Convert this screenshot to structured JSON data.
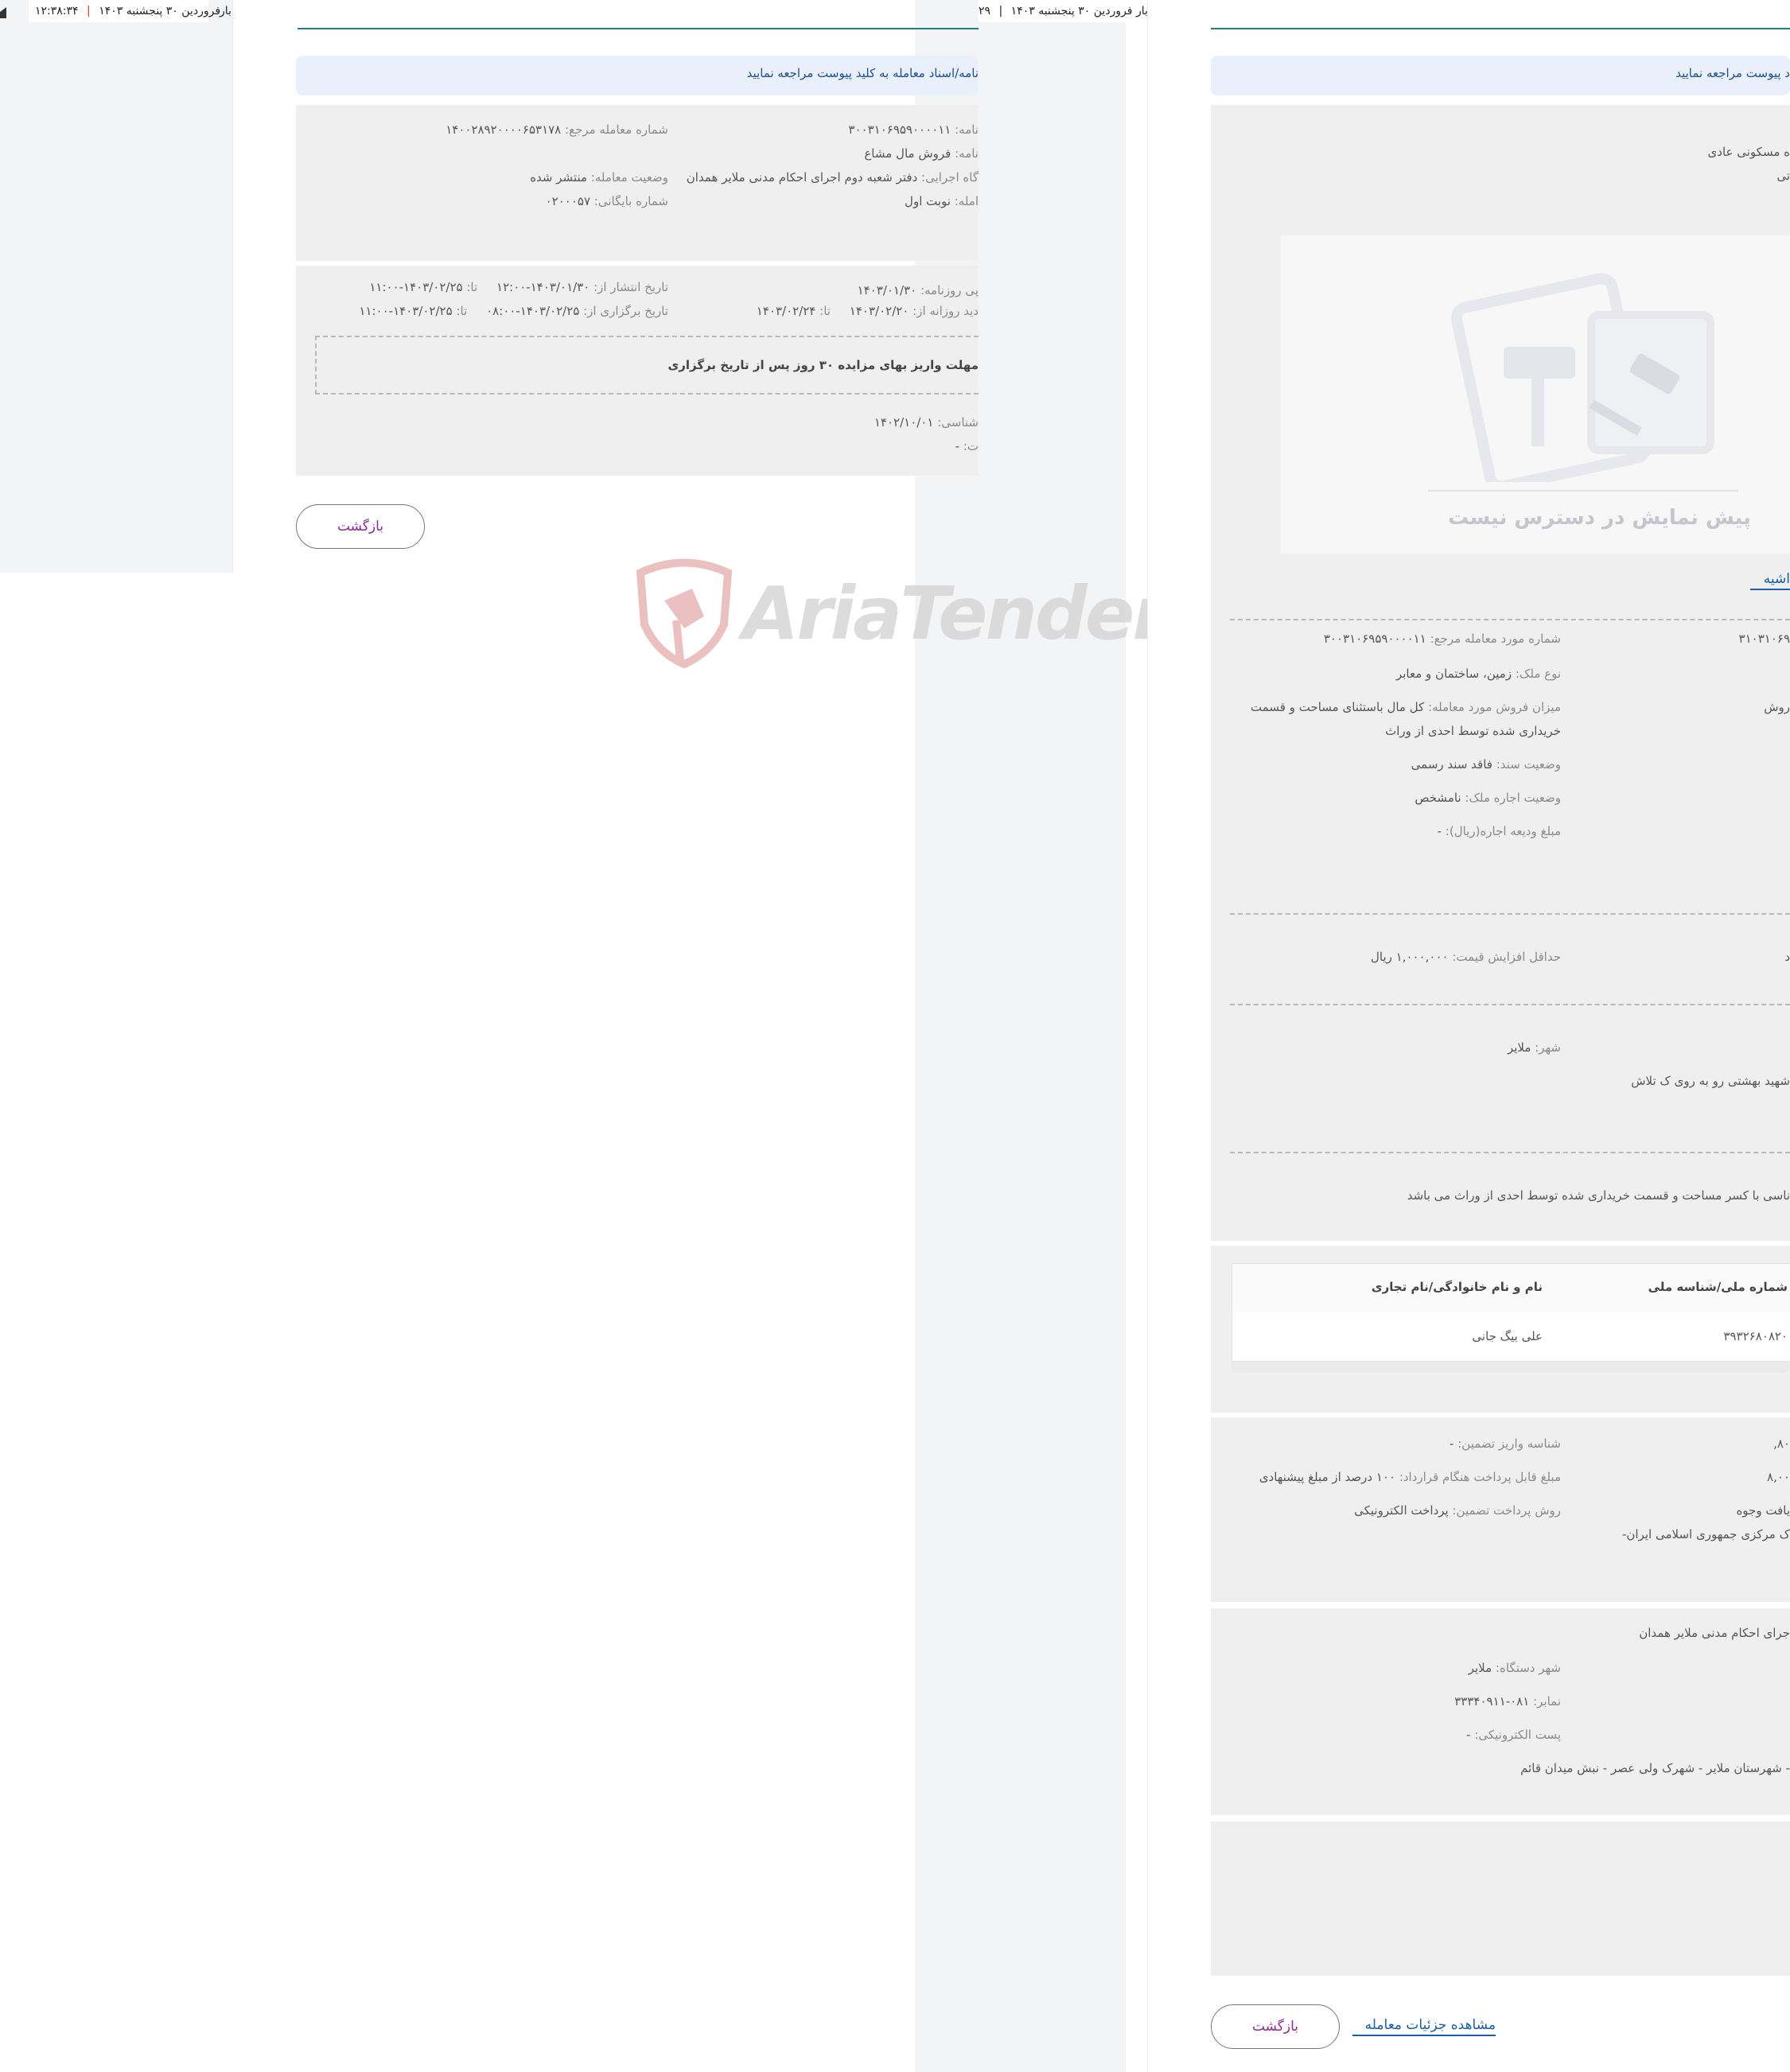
{
  "panel1": {
    "date_text": "فروردین ۳۰ پنجشنبه ۱۴۰۳",
    "time_text": "۱۲:۳۸:۳۴",
    "sep": "|",
    "cut_text": "بار"
  },
  "panel2": {
    "date_text": "فروردین ۳۰ پنجشنبه ۱۴۰۳",
    "sep": "|",
    "time_text": "۲۹",
    "cut_text": "بار",
    "notice": "نامه/اسناد معامله به کلید پیوست مراجعه نمایید",
    "fields": {
      "ref_number_label": "شماره معامله مرجع:",
      "ref_number_value": "۱۴۰۰۲۸۹۲۰۰۰۰۶۵۳۱۷۸",
      "letter_number_label": "نامه:",
      "letter_number_value": "۳۰۰۳۱۰۶۹۵۹۰۰۰۰۱۱",
      "letter_title_label": "نامه:",
      "letter_title_value": "فروش مال مشاع",
      "status_label": "وضعیت معامله:",
      "status_value": "منتشر شده",
      "org_label": "گاه اجرایی:",
      "org_value": "دفتر شعبه دوم اجرای احکام مدنی ملایر همدان",
      "archive_label": "شماره بایگانی:",
      "archive_value": "۰۲۰۰۰۵۷",
      "round_label": "امله:",
      "round_value": "نوبت اول"
    },
    "dates": {
      "paper_label": "پی روزنامه:",
      "paper_value": "۱۴۰۳/۰۱/۳۰",
      "publish_label": "تاریخ انتشار از:",
      "publish_from": "۱۴۰۳/۰۱/۳۰-۱۲:۰۰",
      "to_label": "تا:",
      "publish_to": "۱۴۰۳/۰۲/۲۵-۱۱:۰۰",
      "visit_label": "دید روزانه از:",
      "visit_from": "۱۴۰۳/۰۲/۲۰",
      "visit_to": "۱۴۰۳/۰۲/۲۴",
      "hold_label": "تاریخ برگزاری از:",
      "hold_from": "۱۴۰۳/۰۲/۲۵-۰۸:۰۰",
      "hold_to": "۱۴۰۳/۰۲/۲۵-۱۱:۰۰"
    },
    "note": "مهلت واریز بهای مزایده ۳۰ روز پس از تاریخ برگزاری",
    "expert_label": "شناسی:",
    "expert_value": "۱۴۰۲/۱۰/۰۱",
    "other_label": "ت:",
    "other_value": "-",
    "back_button": "بازگشت"
  },
  "watermark": "AriaTender.neT",
  "panel3": {
    "notice": "د پیوست مراجعه نمایید",
    "top_lines": [
      "ه مسکونی عادی",
      "تی"
    ],
    "preview_text": "پیش نمایش در دسترس نیست",
    "tab_label": "اشیه",
    "section1": {
      "left_id": "۳۱۰۳۱۰۶۹",
      "ref_label": "شماره مورد معامله مرجع:",
      "ref_value": "۳۰۰۳۱۰۶۹۵۹۰۰۰۰۱۱",
      "type_label": "نوع ملک:",
      "type_value": "زمین، ساختمان و معابر",
      "sale_right": "روش",
      "sale_label": "میزان فروش مورد معامله:",
      "sale_value_1": "کل مال باستثنای مساحت و قسمت",
      "sale_value_2": "خریداری شده توسط احدی از وراث",
      "deed_label": "وضعیت سند:",
      "deed_value": "فاقد سند رسمی",
      "lease_label": "وضعیت اجاره ملک:",
      "lease_value": "نامشخص",
      "deposit_label": "مبلغ ودیعه اجاره(ریال):",
      "deposit_value": "-"
    },
    "section2": {
      "right_cut": "د",
      "min_inc_label": "حداقل افزایش قیمت:",
      "min_inc_value": "۱,۰۰۰,۰۰۰ ریال"
    },
    "section3": {
      "city_label": "شهر:",
      "city_value": "ملایر",
      "address": "شهید بهشتی رو به روی ک تلاش"
    },
    "section4": {
      "desc": "ناسی با کسر مساحت و قسمت خریداری شده توسط احدی از وراث می باشد"
    },
    "owners_table": {
      "headers": [
        "شماره ملی/شناسه ملی",
        "نام و نام خانوادگی/نام تجاری"
      ],
      "rows": [
        [
          "۳۹۳۲۶۸۰۸۲۰",
          "علی بیگ جانی"
        ]
      ]
    },
    "payment": {
      "r1_right": "۸۰,",
      "r2_right": "۸,۰۰",
      "r3_right": "یافت وجوه",
      "r4_right": "ک مرکزی جمهوری اسلامی ایران-",
      "deposit_id_label": "شناسه واریز تضمین:",
      "deposit_id_value": "-",
      "contract_pay_label": "مبلغ قابل پرداخت هنگام قرارداد:",
      "contract_pay_value": "۱۰۰ درصد از مبلغ پیشنهادی",
      "method_label": "روش پرداخت تضمین:",
      "method_value": "پرداخت الکترونیکی"
    },
    "org": {
      "name": "جرای احکام مدنی ملایر همدان",
      "city_label": "شهر دستگاه:",
      "city_value": "ملایر",
      "fax_label": "نمابر:",
      "fax_value": "۰۸۱-۳۳۳۴۰۹۱۱",
      "email_label": "پست الکترونیکی:",
      "email_value": "-",
      "address": "- شهرستان ملایر - شهرک ولی عصر - نبش میدان قائم"
    },
    "back_button": "بازگشت",
    "details_link": "مشاهده جزئیات معامله"
  }
}
